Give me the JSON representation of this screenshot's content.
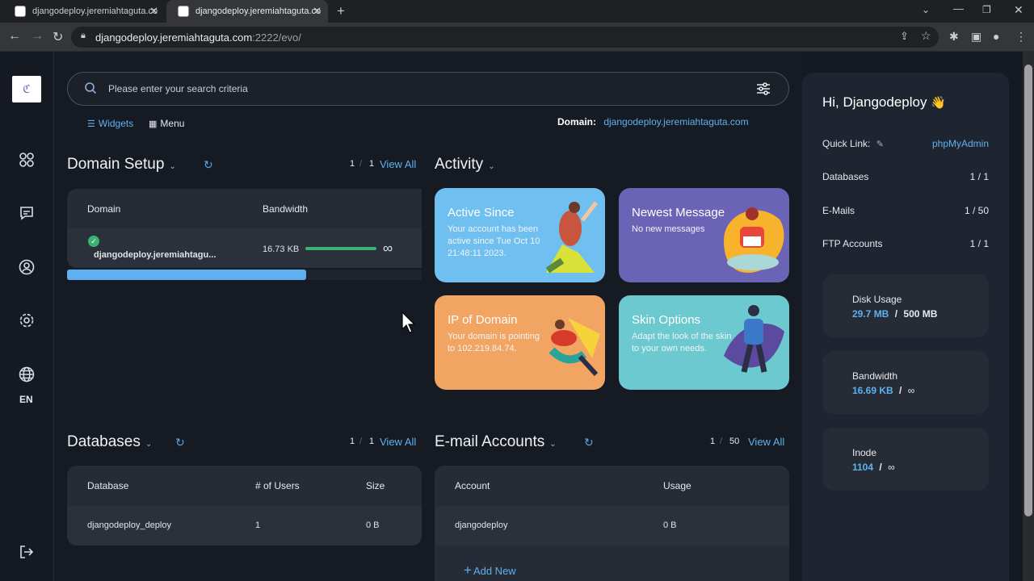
{
  "browser": {
    "tabs": [
      {
        "title": "djangodeploy.jeremiahtaguta.co"
      },
      {
        "title": "djangodeploy.jeremiahtaguta.co"
      }
    ],
    "url_host": "djangodeploy.jeremiahtaguta.com",
    "url_path": ":2222/evo/"
  },
  "search": {
    "placeholder": "Please enter your search criteria"
  },
  "view_toggle": {
    "widgets": "Widgets",
    "menu": "Menu"
  },
  "domain_info": {
    "label": "Domain:",
    "value": "djangodeploy.jeremiahtaguta.com"
  },
  "leftnav": {
    "lang": "EN"
  },
  "domain_setup": {
    "title": "Domain Setup",
    "page_current": "1",
    "page_total": "1",
    "view_all": "View All",
    "headers": {
      "domain": "Domain",
      "bandwidth": "Bandwidth"
    },
    "row": {
      "domain": "djangodeploy.jeremiahtagu...",
      "bandwidth": "16.73 KB",
      "limit": "∞",
      "usage_fraction": 0.0
    }
  },
  "activity": {
    "title": "Activity",
    "cards": [
      {
        "title": "Active Since",
        "text": "Your account has been active since Tue Oct 10 21:48:11 2023.",
        "color": "#6fbff0"
      },
      {
        "title": "Newest Message",
        "text": "No new messages",
        "color": "#6b63b5"
      },
      {
        "title": "IP of Domain",
        "text": "Your domain is pointing to 102.219.84.74.",
        "color": "#f2a463"
      },
      {
        "title": "Skin Options",
        "text": "Adapt the look of the skin to your own needs.",
        "color": "#6cc9d0"
      }
    ]
  },
  "databases": {
    "title": "Databases",
    "page_current": "1",
    "page_total": "1",
    "view_all": "View All",
    "headers": {
      "database": "Database",
      "users": "# of Users",
      "size": "Size"
    },
    "row": {
      "database": "djangodeploy_deploy",
      "users": "1",
      "size": "0 B"
    }
  },
  "email": {
    "title": "E-mail Accounts",
    "page_current": "1",
    "page_total": "50",
    "view_all": "View All",
    "headers": {
      "account": "Account",
      "usage": "Usage"
    },
    "row": {
      "account": "djangodeploy",
      "usage": "0 B"
    },
    "add_new": "Add New"
  },
  "right": {
    "greeting": "Hi, Djangodeploy",
    "wave": "👋",
    "quick_link_label": "Quick Link:",
    "quick_link": "phpMyAdmin",
    "rows": [
      {
        "label": "Databases",
        "value": "1 / 1"
      },
      {
        "label": "E-Mails",
        "value": "1 / 50"
      },
      {
        "label": "FTP Accounts",
        "value": "1 / 1"
      }
    ],
    "disk": {
      "label": "Disk Usage",
      "used": "29.7 MB",
      "sep": "/",
      "total": "500 MB"
    },
    "bandwidth": {
      "label": "Bandwidth",
      "used": "16.69 KB",
      "sep": "/",
      "total": "∞"
    },
    "inode": {
      "label": "Inode",
      "used": "1104",
      "sep": "/",
      "total": "∞"
    }
  },
  "colors": {
    "accent": "#5fb0f0",
    "success": "#3bb273",
    "bg": "#161b23"
  }
}
